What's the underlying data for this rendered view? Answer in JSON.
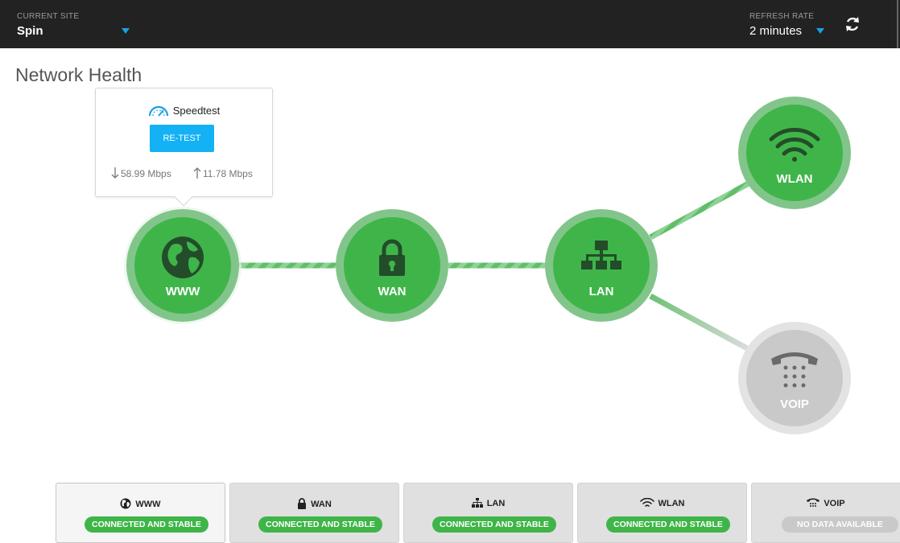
{
  "topbar": {
    "site_label": "CURRENT SITE",
    "site_value": "Spin",
    "rate_label": "REFRESH RATE",
    "rate_value": "2 minutes",
    "accent": "#1aa0e3"
  },
  "page_title": "Network Health",
  "speedtest": {
    "title": "Speedtest",
    "retest_label": "RE-TEST",
    "download": "58.99 Mbps",
    "upload": "11.78 Mbps",
    "button_color": "#14b1f5"
  },
  "nodes": [
    {
      "label": "WWW",
      "icon": "globe-icon",
      "status": "ok"
    },
    {
      "label": "WAN",
      "icon": "lock-icon",
      "status": "ok"
    },
    {
      "label": "LAN",
      "icon": "network-icon",
      "status": "ok"
    },
    {
      "label": "WLAN",
      "icon": "wifi-icon",
      "status": "ok"
    },
    {
      "label": "VOIP",
      "icon": "phone-icon",
      "status": "none"
    }
  ],
  "cards": [
    {
      "label": "WWW",
      "status": "CONNECTED AND STABLE"
    },
    {
      "label": "WAN",
      "status": "CONNECTED AND STABLE"
    },
    {
      "label": "LAN",
      "status": "CONNECTED AND STABLE"
    },
    {
      "label": "WLAN",
      "status": "CONNECTED AND STABLE"
    },
    {
      "label": "VOIP",
      "status": "NO DATA AVAILABLE"
    }
  ],
  "colors": {
    "ok_green": "#3fb549",
    "ok_ring": "#82c58a",
    "none_gray": "#c9c9c9",
    "none_ring": "#e3e3e3",
    "topbar_bg": "#222222"
  }
}
